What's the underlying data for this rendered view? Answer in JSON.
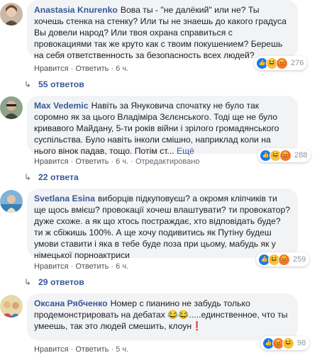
{
  "colors": {
    "link": "#385898",
    "bubble": "#f2f3f5",
    "meta": "#606770"
  },
  "actions": {
    "like": "Нравится",
    "reply": "Ответить",
    "sep": "·"
  },
  "comments": [
    {
      "author": "Anastasia Knurenko",
      "text": "Вова ты - \"не далёкий\" или не? Ты хочешь стенка на стенку? Или ты не знаешь до какого градуса Вы довели народ? Или твоя охрана справиться с провокациями так же круто как с твоим покушением? Берешь на себя ответственность за безопасность всех людей?",
      "more": "",
      "time": "6 ч.",
      "edited": "",
      "reaction_icons": [
        "like-icon",
        "haha-icon",
        "angry-icon"
      ],
      "reaction_count": "276",
      "replies": "55 ответов"
    },
    {
      "author": "Max Vedemic",
      "text": "Навіть за Януковича спочатку не було так соромно як за цього Владіміра Зєлєнського. Тоді ще не було кривавого Майдану, 5-ти років війни і зрілого громадянського суспільства. Було навіть інколи смішно, наприклад коли на нього вінок падав, тощо. Потім ст...",
      "more": "Ещё",
      "time": "6 ч.",
      "edited": "Отредактировано",
      "reaction_icons": [
        "like-icon",
        "haha-icon",
        "angry-icon"
      ],
      "reaction_count": "288",
      "replies": "22 ответа"
    },
    {
      "author": "Svetlana Esina",
      "text": "виборців підкуповуєш? а окромя кліпчиків ти ще щось вмієш? провокації хочеш влаштувати? ти провокатор? дуже схоже. а як що хтось постраждає, хто відповідать буде? ти ж сбіжишь 100%. А ще хочу подивитись як Путіну будеш умови ставити і яка в тебе буде поза при цьому, мабудь як у німецької порноактриси",
      "more": "",
      "time": "6 ч.",
      "edited": "",
      "reaction_icons": [
        "like-icon",
        "haha-icon",
        "angry-icon"
      ],
      "reaction_count": "259",
      "replies": "29 ответов"
    },
    {
      "author": "Оксана Рябченко",
      "text": "Номер с пианино не забудь только продемонстрировать на дебатах 😂😂.....единственное, что ты умеешь, так это людей смешить, клоун❗",
      "more": "",
      "time": "5 ч.",
      "edited": "",
      "reaction_icons": [
        "like-icon",
        "angry-icon",
        "haha-icon"
      ],
      "reaction_count": "98",
      "replies": ""
    }
  ]
}
